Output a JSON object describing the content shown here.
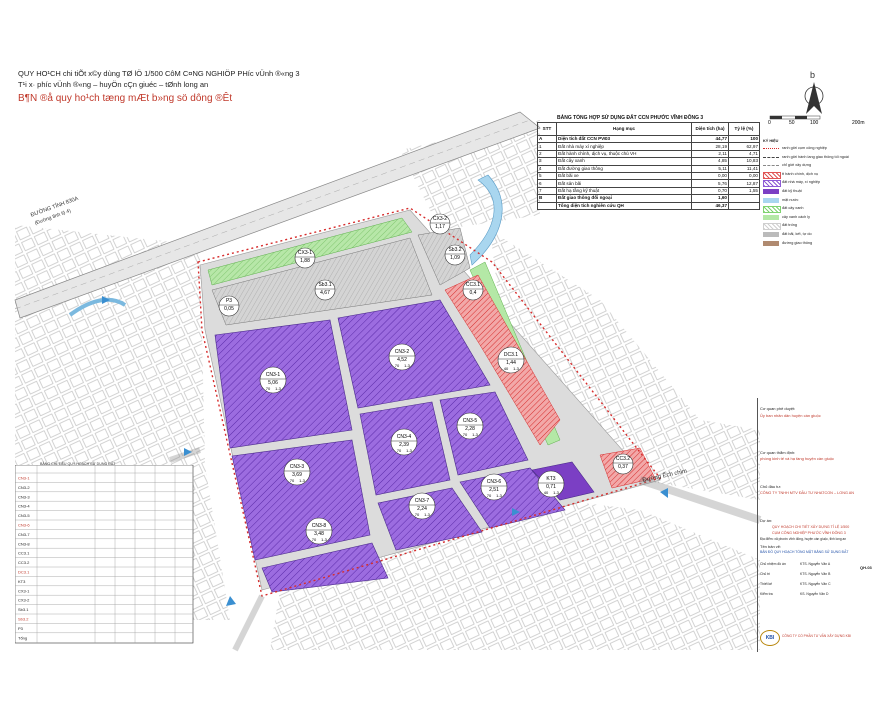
{
  "title": {
    "line1": "QUY HO¹CH chi tiÕt x©y dùng TØ lÖ 1/500 CôM C¤NG NGHIÖP PH­íc vÜnh ®«ng 3",
    "line2": "T¹i x· ph­íc vÜnh ®«ng – huyÖn cÇn giuéc – tØnh long an",
    "line3": "B¶N ®å quy ho¹ch tæng mÆt b»ng sö dông ®Êt"
  },
  "scale_bar": {
    "ticks": [
      "0",
      "50",
      "100",
      "200m"
    ]
  },
  "landuse_table": {
    "caption": "BẢNG TỔNG HỢP SỬ DỤNG ĐẤT CCN PHƯỚC VĨNH ĐÔNG 3",
    "headers": [
      "STT",
      "Hạng mục",
      "Diện tích (ha)",
      "Tỷ lệ (%)"
    ],
    "rows": [
      {
        "stt": "A",
        "item": "Diện tích đất CCN PVĐ3",
        "area": "44,77",
        "pct": "100",
        "bold": true
      },
      {
        "stt": "1",
        "item": "Đất nhà máy xí nghiệp",
        "area": "28,19",
        "pct": "62,97",
        "bold": false
      },
      {
        "stt": "2",
        "item": "Đất hành chính, dịch vụ, thuộc chủ VH",
        "area": "2,11",
        "pct": "4,71",
        "bold": false
      },
      {
        "stt": "3",
        "item": "Đất cây xanh",
        "area": "4,85",
        "pct": "10,83",
        "bold": false
      },
      {
        "stt": "4",
        "item": "Đất đường giao thông",
        "area": "5,11",
        "pct": "11,41",
        "bold": false
      },
      {
        "stt": "5",
        "item": "Đất bãi xe",
        "area": "0,00",
        "pct": "0,00",
        "bold": false
      },
      {
        "stt": "6",
        "item": "Đất sản bãi",
        "area": "5,76",
        "pct": "12,87",
        "bold": false
      },
      {
        "stt": "7",
        "item": "Đất hạ tầng kỹ thuật",
        "area": "0,70",
        "pct": "1,55",
        "bold": false
      },
      {
        "stt": "B",
        "item": "Đất giao thông đối ngoại",
        "area": "1,60",
        "pct": "",
        "bold": true
      },
      {
        "stt": "",
        "item": "Tổng diện tích nghiên cứu QH",
        "area": "46,37",
        "pct": "",
        "bold": true
      }
    ]
  },
  "legend": {
    "heading": "KÝ HIỆU",
    "items": [
      {
        "label": "ranh giới cụm công nghiệp",
        "color": "#d62c2c",
        "style": "dots"
      },
      {
        "label": "ranh giới hành lang giao thông tối ngoài",
        "color": "#444444",
        "style": "dash"
      },
      {
        "label": "chỉ giới xây dựng",
        "color": "#888888",
        "style": "dash"
      },
      {
        "label": "tt hành chính, dịch vụ",
        "color": "#e05555",
        "style": "hatch"
      },
      {
        "label": "đất nhà máy, xí nghiệp",
        "color": "#8e5bd6",
        "style": "hatch"
      },
      {
        "label": "đất kỹ thuật",
        "color": "#7b3fc4",
        "style": "solid"
      },
      {
        "label": "mặt nước",
        "color": "#a9d6ef",
        "style": "solid"
      },
      {
        "label": "đất cây xanh",
        "color": "#7fd36f",
        "style": "hatch"
      },
      {
        "label": "cây xanh cách ly",
        "color": "#b4e8a6",
        "style": "solid"
      },
      {
        "label": "đất trống",
        "color": "#cfcfcf",
        "style": "hatch"
      },
      {
        "label": "đất bãi, kết, tự do",
        "color": "#bbbbbb",
        "style": "solid"
      },
      {
        "label": "đường giao thông",
        "color": "#b08a70",
        "style": "solid"
      }
    ]
  },
  "zones": [
    {
      "id": "CN3-1",
      "area": "5,06",
      "density": "70",
      "floors": "1-3"
    },
    {
      "id": "CN3-2",
      "area": "4,52",
      "density": "70",
      "floors": "1-3"
    },
    {
      "id": "CN3-3",
      "area": "3,69",
      "density": "70",
      "floors": "1-3"
    },
    {
      "id": "CN3-4",
      "area": "2,39",
      "density": "70",
      "floors": "1-3"
    },
    {
      "id": "CN3-5",
      "area": "2,28",
      "density": "70",
      "floors": "1-3"
    },
    {
      "id": "CN3-6",
      "area": "2,51",
      "density": "70",
      "floors": "1-3"
    },
    {
      "id": "CN3-7",
      "area": "2,24",
      "density": "70",
      "floors": "1-3"
    },
    {
      "id": "CN3-8",
      "area": "3,48",
      "density": "70",
      "floors": "1-3"
    },
    {
      "id": "CX3-1",
      "area": "1,88",
      "density": "",
      "floors": ""
    },
    {
      "id": "CX3-2",
      "area": "1,17",
      "density": "",
      "floors": ""
    },
    {
      "id": "Sb3.1",
      "area": "4,67",
      "density": "",
      "floors": ""
    },
    {
      "id": "Sb3.2",
      "area": "1,09",
      "density": "",
      "floors": ""
    },
    {
      "id": "CC3.1",
      "area": "0,4",
      "density": "",
      "floors": ""
    },
    {
      "id": "CC3.2",
      "area": "0,37",
      "density": "",
      "floors": ""
    },
    {
      "id": "DC3.1",
      "area": "1,44",
      "density": "40",
      "floors": "1-3"
    },
    {
      "id": "KT3",
      "area": "0,71",
      "density": "40",
      "floors": "1-3"
    },
    {
      "id": "P3",
      "area": "0,05",
      "density": "",
      "floors": ""
    }
  ],
  "roads": {
    "provincial": "ĐƯỜNG TỈNH 830A",
    "provincial_sub": "(Đường tỉnh lộ 4)",
    "east": "Đường Ếch chim"
  },
  "title_block": {
    "agency_label": "Cơ quan phê duyệt:",
    "agency": "Ủy ban nhân dân huyện cần giuộc",
    "agency2_label": "Cơ quan thẩm định:",
    "agency2": "phòng kinh tế và hạ tầng huyện cần giuộc",
    "investor_label": "Chủ đầu tư:",
    "investor": "CÔNG TY TNHH MTV ĐẦU TƯ NHATCON – LONG AN",
    "project_label": "Dự án:",
    "project": "QUY HOẠCH CHI TIẾT XÂY DỰNG TỈ LỆ 1/500",
    "project2": "CỤM CÔNG NGHIỆP PHƯỚC VĨNH ĐÔNG 3",
    "location": "Địa điểm: xã phước vĩnh đông, huyện cần giuộc, tỉnh long an",
    "drawing_label": "Tên bản vẽ:",
    "drawing": "BẢN ĐỒ QUY HOẠCH TỔNG MẶT BẰNG SỬ DỤNG ĐẤT",
    "staff": [
      {
        "role": "Chủ nhiệm đồ án",
        "name": "KTS. Nguyễn Văn A"
      },
      {
        "role": "Chủ trì",
        "name": "KTS. Nguyễn Văn B"
      },
      {
        "role": "Thiết kế",
        "name": "KTS. Nguyễn Văn C"
      },
      {
        "role": "Kiểm tra",
        "name": "KS. Nguyễn Văn D"
      }
    ],
    "consultant_logo": "KBI",
    "consultant": "CÔNG TY CỔ PHẦN TƯ VẤN XÂY DỰNG KBI",
    "sheet_no": "QH-03"
  },
  "left_table": {
    "caption": "BẢNG CHỈ TIÊU QUY HOẠCH SỬ DỤNG ĐẤT",
    "rows": [
      "CN3-1",
      "CN3-2",
      "CN3-3",
      "CN3-4",
      "CN3-5",
      "CN3-6",
      "CN3-7",
      "CN3-8",
      "CC3.1",
      "CC3.2",
      "DC3.1",
      "KT3",
      "CX3-1",
      "CX3-2",
      "Sb3.1",
      "Sb3.2",
      "P3",
      "Tổng"
    ]
  },
  "colors": {
    "industrial": "#8e5bd6",
    "service": "#e05555",
    "green": "#7fd36f",
    "boundary": "#d62c2c",
    "water": "#a9d6ef",
    "road": "#cfcfcf"
  }
}
